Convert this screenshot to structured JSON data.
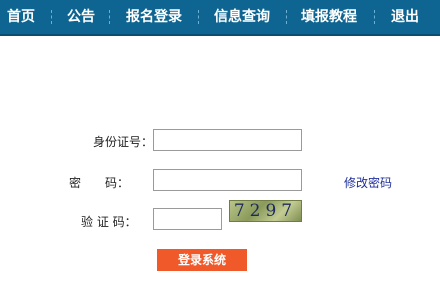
{
  "nav": {
    "items": [
      {
        "label": "首页"
      },
      {
        "label": "公告"
      },
      {
        "label": "报名登录"
      },
      {
        "label": "信息查询"
      },
      {
        "label": "填报教程"
      },
      {
        "label": "退出"
      }
    ]
  },
  "form": {
    "id_label": "身份证号：",
    "id_value": "",
    "password_label": "密　　码：",
    "password_value": "",
    "change_password_link": "修改密码",
    "captcha_label": "验 证 码：",
    "captcha_value": "",
    "captcha_image_text": "7297",
    "submit_label": "登录系统"
  },
  "colors": {
    "nav_bg": "#0f6591",
    "button_bg": "#f05a2a",
    "link": "#1f2f9b"
  }
}
